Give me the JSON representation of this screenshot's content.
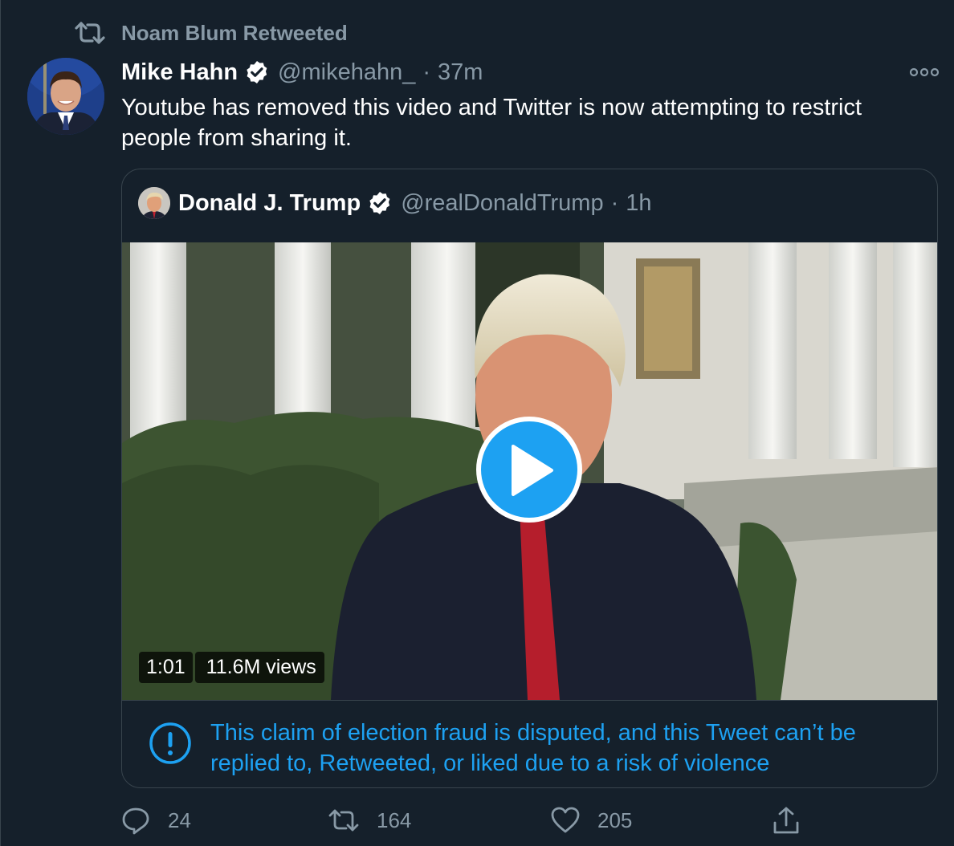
{
  "retweet_context": {
    "text": "Noam Blum Retweeted"
  },
  "tweet": {
    "author_name": "Mike Hahn",
    "handle": "@mikehahn_",
    "separator": "·",
    "time": "37m",
    "text": "Youtube has removed this video and Twitter is now attempting to restrict people from sharing it."
  },
  "quoted_tweet": {
    "author_name": "Donald J. Trump",
    "handle": "@realDonaldTrump",
    "separator": "·",
    "time": "1h",
    "video": {
      "duration": "1:01",
      "views": "11.6M views"
    },
    "notice": "This claim of election fraud is disputed, and this Tweet can’t be replied to, Retweeted, or liked due to a risk of violence"
  },
  "actions": {
    "replies": "24",
    "retweets": "164",
    "likes": "205"
  },
  "icons": [
    "retweet-icon",
    "verified-icon",
    "more-icon",
    "play-icon",
    "info-icon",
    "reply-icon",
    "like-icon",
    "share-icon"
  ],
  "colors": {
    "background": "#15202b",
    "accent": "#1da1f2",
    "secondary_text": "#8899a6",
    "border": "#38444d"
  }
}
